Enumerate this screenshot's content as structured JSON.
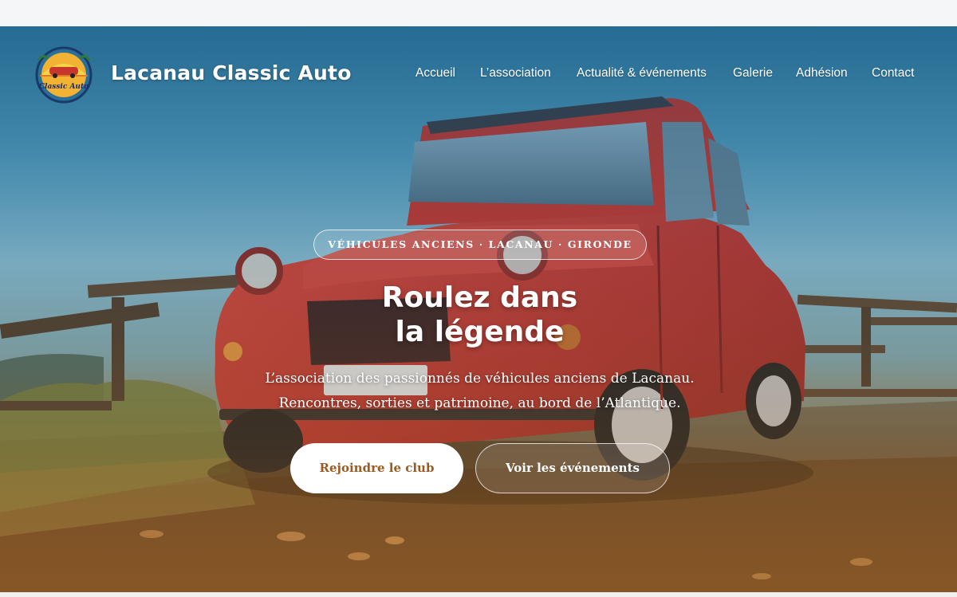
{
  "brand": {
    "name": "Lacanau Classic Auto",
    "logo_text": "Classic Auto",
    "logo_icon": "car-sunset-badge-icon"
  },
  "nav": {
    "items": [
      {
        "label": "Accueil",
        "active": true
      },
      {
        "label": "L’association",
        "active": false
      },
      {
        "label": "Actualité & événements",
        "active": false
      },
      {
        "label": "Galerie",
        "active": false
      },
      {
        "label": "Adhésion",
        "active": false
      },
      {
        "label": "Contact",
        "active": false
      }
    ]
  },
  "hero": {
    "eyebrow": "VÉHICULES ANCIENS · LACANAU · GIRONDE",
    "title_line1": "Roulez dans",
    "title_line2": "la légende",
    "subtitle_line1": "L’association des passionnés de véhicules anciens de Lacanau.",
    "subtitle_line2": "Rencontres, sorties et patrimoine, au bord de l’Atlantique.",
    "cta_primary": "Rejoindre le club",
    "cta_secondary": "Voir les événements",
    "background": "red-2cv-car-photo"
  },
  "colors": {
    "accent": "#9a5a22",
    "car_red": "#c8372c",
    "sky": "#2f7fa6"
  }
}
